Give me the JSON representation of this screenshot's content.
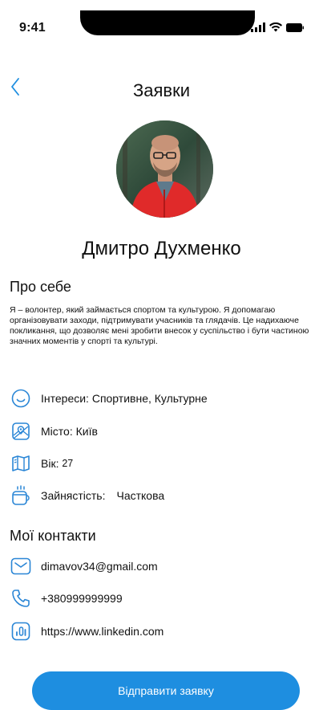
{
  "status_bar": {
    "time": "9:41"
  },
  "header": {
    "title": "Заявки"
  },
  "profile": {
    "name": "Дмитро Духменко"
  },
  "about": {
    "title": "Про себе",
    "text": "Я – волонтер, який займається спортом та культурою. Я допомагаю організовувати заходи, підтримувати учасників та глядачів. Це надихаюче покликання, що дозволяє мені зробити внесок у суспільство і бути частиною значних моментів у спорті та культурі."
  },
  "info": {
    "interests": "Інтереси: Спортивне, Культурне",
    "city": "Місто: Київ",
    "age_label": "Вік:",
    "age_value": "27",
    "employment_label": "Зайнястість:",
    "employment_value": "Часткова"
  },
  "contacts": {
    "title": "Мої контакти",
    "email": "dimavov34@gmail.com",
    "phone": "+380999999999",
    "linkedin": "https://www.linkedin.com"
  },
  "actions": {
    "submit_label": "Відправити заявку"
  },
  "colors": {
    "accent": "#1e8ee0",
    "icon": "#2a86d6"
  }
}
